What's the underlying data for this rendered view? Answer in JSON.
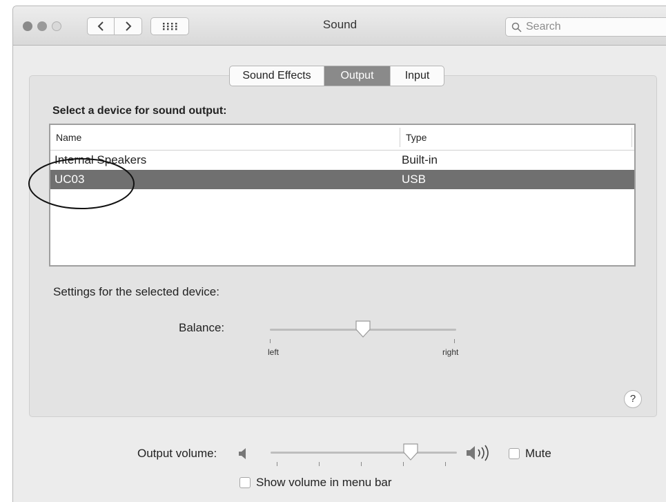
{
  "window": {
    "title": "Sound",
    "search_placeholder": "Search"
  },
  "tabs": [
    {
      "label": "Sound Effects",
      "selected": false
    },
    {
      "label": "Output",
      "selected": true
    },
    {
      "label": "Input",
      "selected": false
    }
  ],
  "output": {
    "heading": "Select a device for sound output:",
    "columns": {
      "name": "Name",
      "type": "Type"
    },
    "devices": [
      {
        "name": "Internal Speakers",
        "type": "Built-in",
        "selected": false
      },
      {
        "name": "UC03",
        "type": "USB",
        "selected": true
      }
    ],
    "settings_heading": "Settings for the selected device:",
    "balance": {
      "label": "Balance:",
      "left_label": "left",
      "right_label": "right",
      "value": 0.5
    },
    "help_label": "?"
  },
  "volume": {
    "label": "Output volume:",
    "value": 0.75,
    "mute_label": "Mute",
    "mute_checked": false,
    "show_in_menu_bar_label": "Show volume in menu bar",
    "show_in_menu_bar_checked": false
  },
  "colors": {
    "selected_row": "#707070",
    "selected_tab": "#8a8a8a",
    "window_bg": "#ececec"
  }
}
